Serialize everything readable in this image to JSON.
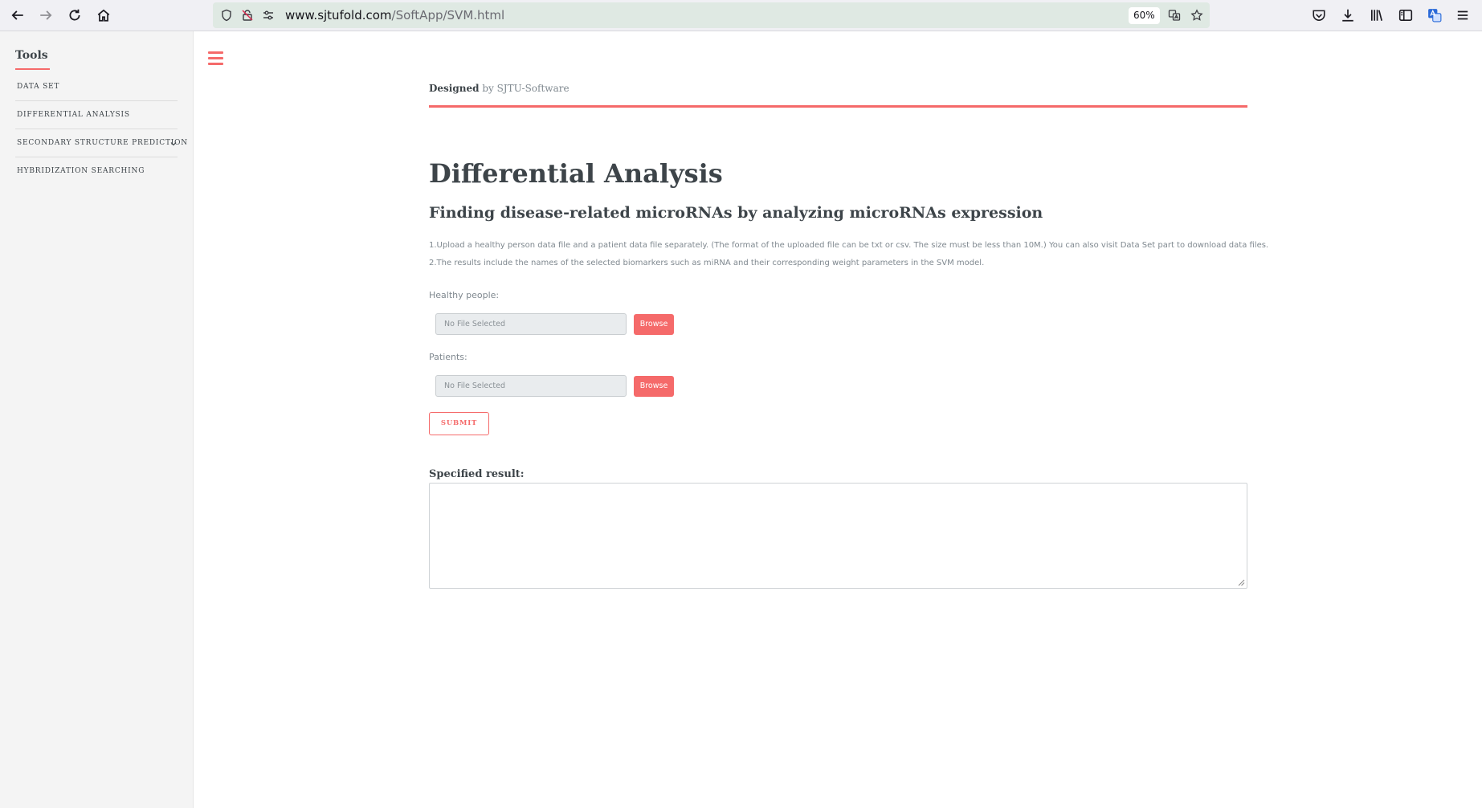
{
  "browser": {
    "url_domain": "www.sjtufold.com",
    "url_path": "/SoftApp/SVM.html",
    "zoom": "60%"
  },
  "sidebar": {
    "title": "Tools",
    "items": [
      {
        "label": "DATA SET"
      },
      {
        "label": "DIFFERENTIAL ANALYSIS"
      },
      {
        "label": "SECONDARY STRUCTURE PREDICTION"
      },
      {
        "label": "HYBRIDIZATION SEARCHING"
      }
    ]
  },
  "header": {
    "designed_bold": "Designed",
    "designed_rest": " by SJTU-Software"
  },
  "main": {
    "title": "Differential Analysis",
    "subtitle": "Finding disease-related microRNAs by analyzing microRNAs expression",
    "instructions": [
      "1.Upload a healthy person data file and a patient data file separately. (The format of the uploaded file can be txt or csv. The size must be less than 10M.) You can also visit Data Set part to download data files.",
      "2.The results include the names of the selected biomarkers such as miRNA and their corresponding weight parameters in the SVM model."
    ],
    "healthy_label": "Healthy people:",
    "patients_label": "Patients:",
    "file_placeholder": "No File Selected",
    "browse_label": "Browse",
    "submit_label": "SUBMIT",
    "result_label": "Specified result:",
    "result_value": ""
  },
  "colors": {
    "accent": "#f56a6a",
    "text": "#3d4449",
    "muted": "#7f888f",
    "urlbar": "#dfe9e3",
    "sidebar_bg": "#f4f4f4"
  }
}
